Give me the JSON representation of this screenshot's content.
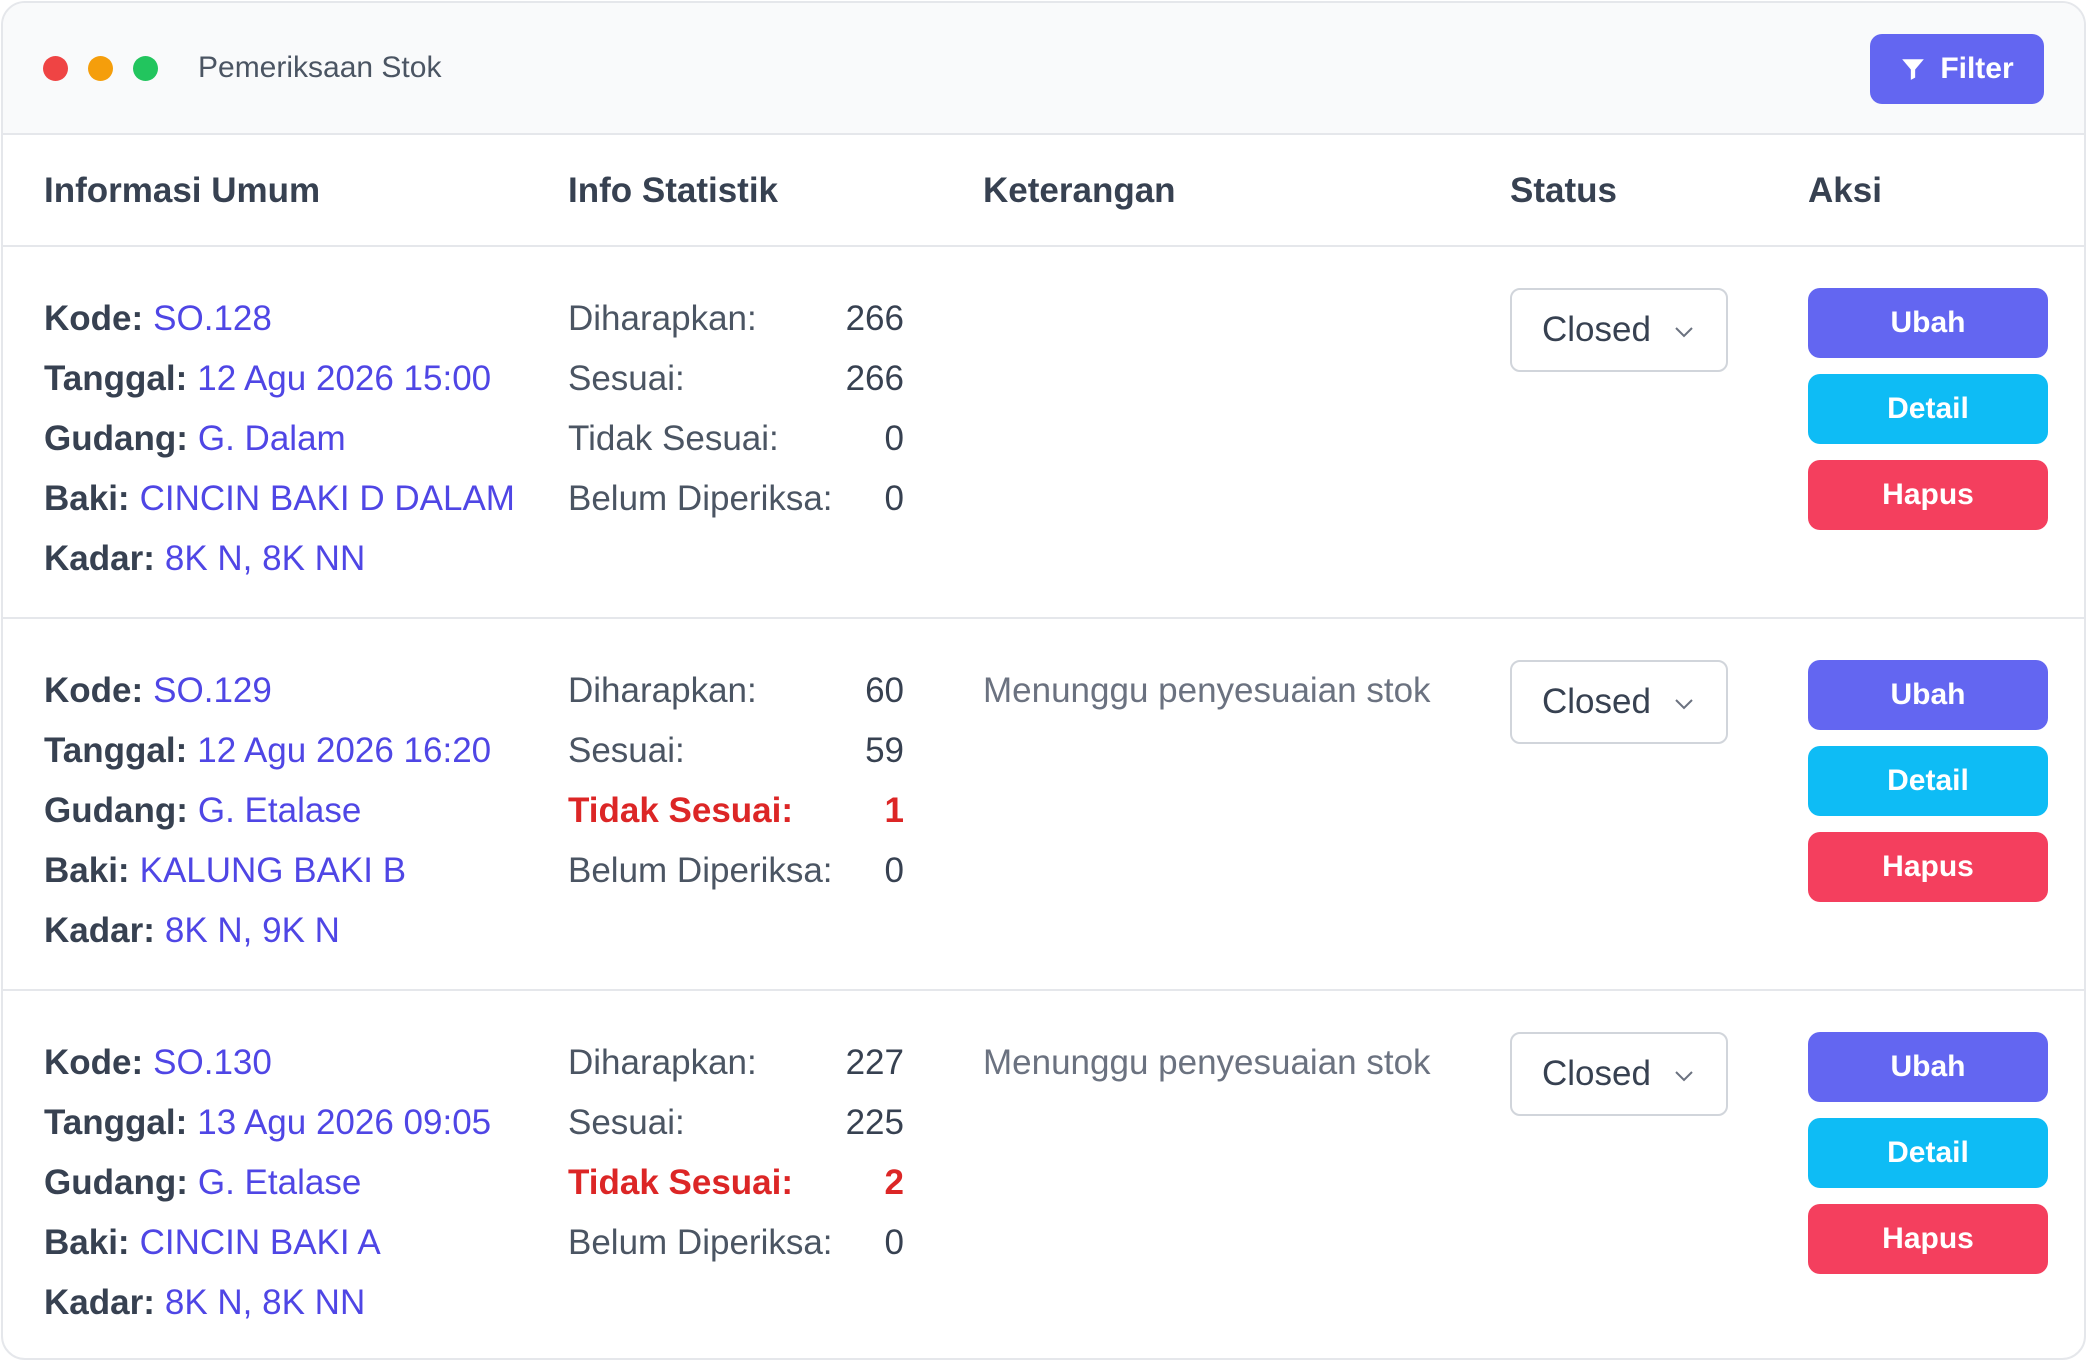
{
  "window": {
    "title": "Pemeriksaan Stok",
    "filter_label": "Filter"
  },
  "columns": {
    "info": "Informasi Umum",
    "stats": "Info Statistik",
    "note": "Keterangan",
    "status": "Status",
    "action": "Aksi"
  },
  "labels": {
    "kode": "Kode:",
    "tanggal": "Tanggal:",
    "gudang": "Gudang:",
    "baki": "Baki:",
    "kadar": "Kadar:",
    "diharapkan": "Diharapkan:",
    "sesuai": "Sesuai:",
    "tidak_sesuai": "Tidak Sesuai:",
    "belum": "Belum Diperiksa:",
    "ubah": "Ubah",
    "detail": "Detail",
    "hapus": "Hapus"
  },
  "colors": {
    "accent": "#6366f1",
    "detail": "#0ebcf5",
    "danger": "#f43f5e",
    "link": "#4f46e5",
    "warning_text": "#dc2626"
  },
  "rows": [
    {
      "kode": "SO.128",
      "tanggal": "12 Agu 2026 15:00",
      "gudang": "G. Dalam",
      "baki": "CINCIN BAKI D DALAM",
      "kadar": "8K N, 8K NN",
      "diharapkan": "266",
      "sesuai": "266",
      "tidak_sesuai": "0",
      "belum": "0",
      "keterangan": "",
      "status": "Closed"
    },
    {
      "kode": "SO.129",
      "tanggal": "12 Agu 2026 16:20",
      "gudang": "G. Etalase",
      "baki": "KALUNG BAKI B",
      "kadar": "8K N, 9K N",
      "diharapkan": "60",
      "sesuai": "59",
      "tidak_sesuai": "1",
      "belum": "0",
      "keterangan": "Menunggu penyesuaian stok",
      "status": "Closed"
    },
    {
      "kode": "SO.130",
      "tanggal": "13 Agu 2026 09:05",
      "gudang": "G. Etalase",
      "baki": "CINCIN BAKI A",
      "kadar": "8K N, 8K NN",
      "diharapkan": "227",
      "sesuai": "225",
      "tidak_sesuai": "2",
      "belum": "0",
      "keterangan": "Menunggu penyesuaian stok",
      "status": "Closed"
    }
  ]
}
